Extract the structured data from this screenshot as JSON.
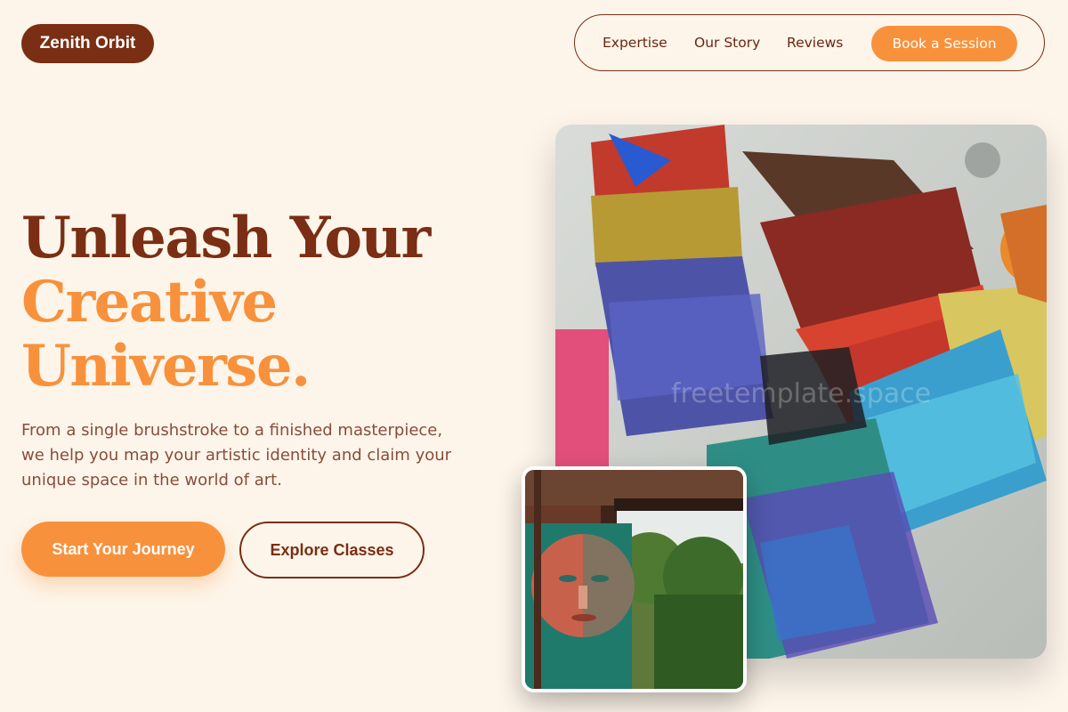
{
  "brand": {
    "name": "Zenith Orbit"
  },
  "nav": {
    "links": [
      "Expertise",
      "Our Story",
      "Reviews"
    ],
    "cta": "Book a Session"
  },
  "hero": {
    "title_line1": "Unleash Your",
    "title_line2": "Creative",
    "title_line3": "Universe.",
    "subtitle_lines": [
      "From a single brushstroke to a finished masterpiece,",
      "we help you map your artistic identity and claim your",
      "unique space in the world of art."
    ],
    "primary_cta": "Start Your Journey",
    "secondary_cta": "Explore Classes"
  },
  "media": {
    "watermark": "freetemplate.space"
  },
  "colors": {
    "background": "#fdf5ea",
    "brand_dark": "#7a2e14",
    "accent": "#f8913c",
    "body_text": "#8a4c3a"
  }
}
